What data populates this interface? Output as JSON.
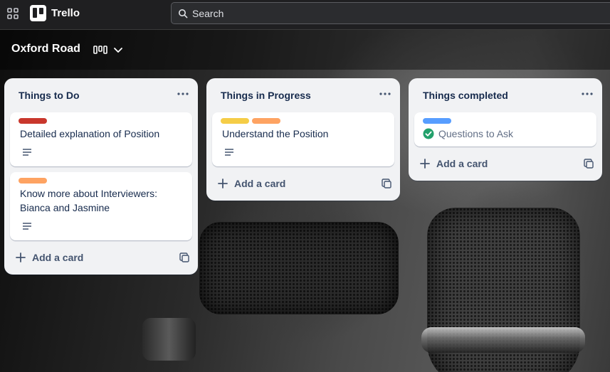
{
  "topbar": {
    "app_name": "Trello",
    "search_placeholder": "Search",
    "apps_icon": "apps-grid-icon",
    "search_icon": "search-icon"
  },
  "board": {
    "title": "Oxford Road",
    "view_icon": "board-view-icon",
    "chevron_icon": "chevron-down-icon"
  },
  "lists": [
    {
      "title": "Things to Do",
      "add_label": "Add a card",
      "cards": [
        {
          "labels": [
            "#c9372c"
          ],
          "title": "Detailed explanation of Position",
          "has_description": true
        },
        {
          "labels": [
            "#fea362"
          ],
          "title_lines": [
            "Know more about Interviewers:",
            "Bianca and Jasmine"
          ],
          "has_description": true
        }
      ]
    },
    {
      "title": "Things in Progress",
      "add_label": "Add a card",
      "cards": [
        {
          "labels": [
            "#f5cd47",
            "#fea362"
          ],
          "title": "Understand the Position",
          "has_description": true
        }
      ]
    },
    {
      "title": "Things completed",
      "add_label": "Add a card",
      "cards": [
        {
          "labels": [
            "#579dff"
          ],
          "title": "Questions to Ask",
          "complete": true,
          "check_color": "#22a06b"
        }
      ]
    }
  ],
  "colors": {
    "list_bg": "#f1f2f4",
    "text": "#172b4d",
    "muted": "#44546f"
  }
}
